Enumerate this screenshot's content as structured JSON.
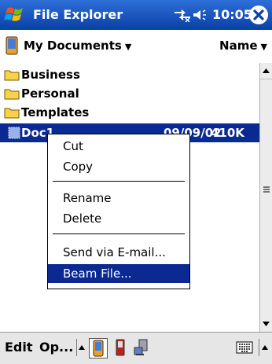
{
  "titlebar": {
    "app_title": "File Explorer",
    "clock": "10:05",
    "icons": [
      "windows-start-flag-icon",
      "connectivity-icon",
      "volume-icon",
      "close-icon"
    ]
  },
  "header": {
    "folder": "My Documents",
    "sort": "Name"
  },
  "files": [
    {
      "name": "Business",
      "type": "folder"
    },
    {
      "name": "Personal",
      "type": "folder"
    },
    {
      "name": "Templates",
      "type": "folder"
    },
    {
      "name": "Doc1",
      "type": "document",
      "date": "09/09/02",
      "size": "410K",
      "selected": true
    }
  ],
  "context_menu": {
    "items": [
      "Cut",
      "Copy",
      "Rename",
      "Delete",
      "Send via E-mail...",
      "Beam File..."
    ],
    "highlighted": "Beam File..."
  },
  "menubar": {
    "edit": "Edit",
    "open": "Op...",
    "icons": [
      "up-arrow-icon",
      "device-icon",
      "storage-card-icon",
      "network-icon",
      "keyboard-icon"
    ]
  },
  "colors": {
    "title_bar": "#1350c0",
    "selection": "#0a2a92",
    "menubar": "#e6e6e6"
  }
}
